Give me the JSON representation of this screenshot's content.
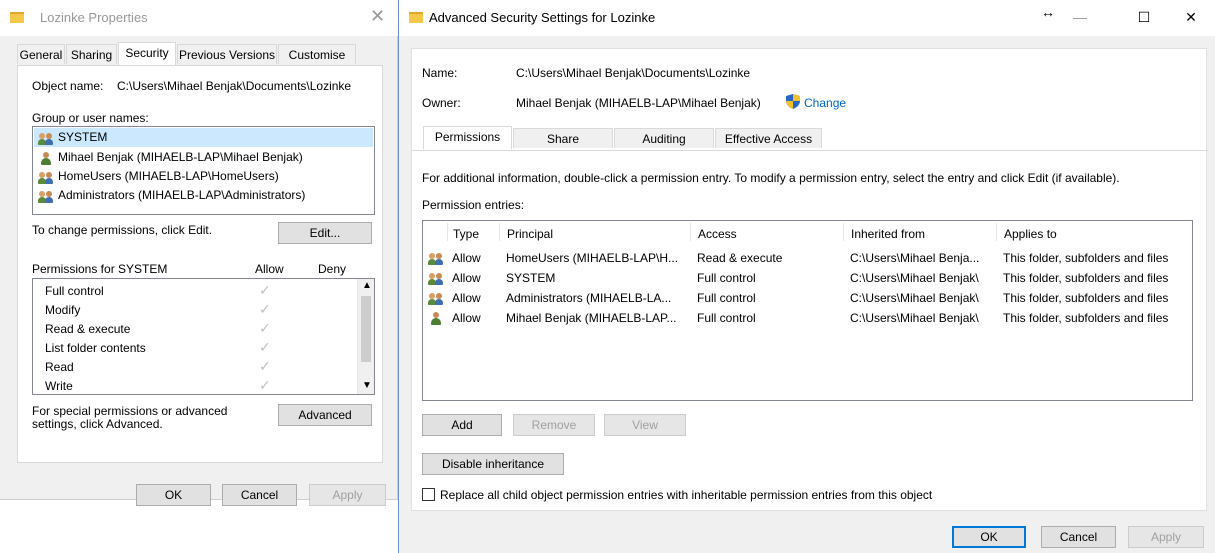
{
  "props": {
    "title": "Lozinke Properties",
    "tabs": [
      "General",
      "Sharing",
      "Security",
      "Previous Versions",
      "Customise"
    ],
    "object_name_label": "Object name:",
    "object_name_value": "C:\\Users\\Mihael Benjak\\Documents\\Lozinke",
    "group_label": "Group or user names:",
    "users": [
      {
        "name": "SYSTEM",
        "icon": "users-icon"
      },
      {
        "name": "Mihael Benjak (MIHAELB-LAP\\Mihael Benjak)",
        "icon": "user-icon"
      },
      {
        "name": "HomeUsers (MIHAELB-LAP\\HomeUsers)",
        "icon": "users-icon"
      },
      {
        "name": "Administrators (MIHAELB-LAP\\Administrators)",
        "icon": "users-icon"
      }
    ],
    "change_text": "To change permissions, click Edit.",
    "edit_label": "Edit...",
    "perm_for": "Permissions for SYSTEM",
    "allow": "Allow",
    "deny": "Deny",
    "perms": [
      "Full control",
      "Modify",
      "Read & execute",
      "List folder contents",
      "Read",
      "Write"
    ],
    "special_text": "For special permissions or advanced settings, click Advanced.",
    "advanced_label": "Advanced",
    "ok": "OK",
    "cancel": "Cancel",
    "apply": "Apply"
  },
  "adv": {
    "title": "Advanced Security Settings for Lozinke",
    "name_label": "Name:",
    "name_value": "C:\\Users\\Mihael Benjak\\Documents\\Lozinke",
    "owner_label": "Owner:",
    "owner_value": "Mihael Benjak (MIHAELB-LAP\\Mihael Benjak)",
    "change_link": "Change",
    "tabs": [
      "Permissions",
      "Share",
      "Auditing",
      "Effective Access"
    ],
    "info": "For additional information, double-click a permission entry. To modify a permission entry, select the entry and click Edit (if available).",
    "entries_label": "Permission entries:",
    "columns": [
      "Type",
      "Principal",
      "Access",
      "Inherited from",
      "Applies to"
    ],
    "rows": [
      {
        "icon": "users-icon",
        "type": "Allow",
        "principal": "HomeUsers (MIHAELB-LAP\\H...",
        "access": "Read & execute",
        "inherited": "C:\\Users\\Mihael Benja...",
        "applies": "This folder, subfolders and files"
      },
      {
        "icon": "users-icon",
        "type": "Allow",
        "principal": "SYSTEM",
        "access": "Full control",
        "inherited": "C:\\Users\\Mihael Benjak\\",
        "applies": "This folder, subfolders and files"
      },
      {
        "icon": "users-icon",
        "type": "Allow",
        "principal": "Administrators (MIHAELB-LA...",
        "access": "Full control",
        "inherited": "C:\\Users\\Mihael Benjak\\",
        "applies": "This folder, subfolders and files"
      },
      {
        "icon": "user-icon",
        "type": "Allow",
        "principal": "Mihael Benjak (MIHAELB-LAP...",
        "access": "Full control",
        "inherited": "C:\\Users\\Mihael Benjak\\",
        "applies": "This folder, subfolders and files"
      }
    ],
    "add": "Add",
    "remove": "Remove",
    "view": "View",
    "disable_inheritance": "Disable inheritance",
    "replace_text": "Replace all child object permission entries with inheritable permission entries from this object",
    "ok": "OK",
    "cancel": "Cancel",
    "apply": "Apply"
  }
}
